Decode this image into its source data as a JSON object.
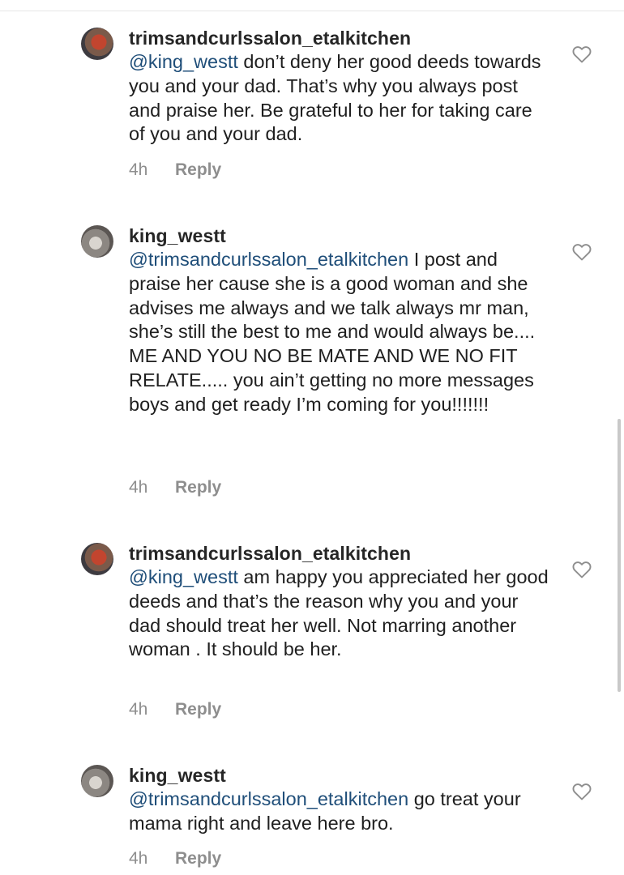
{
  "comments": [
    {
      "username": "trimsandcurlssalon_etalkitchen",
      "mention": "@king_westt",
      "text": " don’t deny her good deeds towards you and your dad. That’s why you always post and praise her. Be grateful to her for taking care of you and your dad.",
      "time": "4h",
      "reply_label": "Reply",
      "avatar_icon": "avatar-trimsandcurls",
      "like_icon": "heart-outline-icon"
    },
    {
      "username": "king_westt",
      "mention": "@trimsandcurlssalon_etalkitchen",
      "text": " I post and praise her cause she is a good woman and she advises me always and we talk always mr man, she’s still the best to me and would always be.... ME AND YOU NO BE MATE AND WE NO FIT RELATE..... you ain’t getting no more messages boys and get ready I’m coming for you!!!!!!!",
      "time": "4h",
      "reply_label": "Reply",
      "avatar_icon": "avatar-king-westt",
      "like_icon": "heart-outline-icon"
    },
    {
      "username": "trimsandcurlssalon_etalkitchen",
      "mention": "@king_westt",
      "text": " am happy you appreciated her good deeds and that’s the reason why you and your dad should treat her well. Not marring another woman . It should be her.",
      "time": "4h",
      "reply_label": "Reply",
      "avatar_icon": "avatar-trimsandcurls",
      "like_icon": "heart-outline-icon"
    },
    {
      "username": "king_westt",
      "mention": "@trimsandcurlssalon_etalkitchen",
      "text": " go treat your mama right and leave here bro.",
      "time": "4h",
      "reply_label": "Reply",
      "avatar_icon": "avatar-king-westt",
      "like_icon": "heart-outline-icon"
    }
  ],
  "colors": {
    "mention": "#1f4e79",
    "meta": "#8e8e8e",
    "text": "#1f1f1f"
  }
}
